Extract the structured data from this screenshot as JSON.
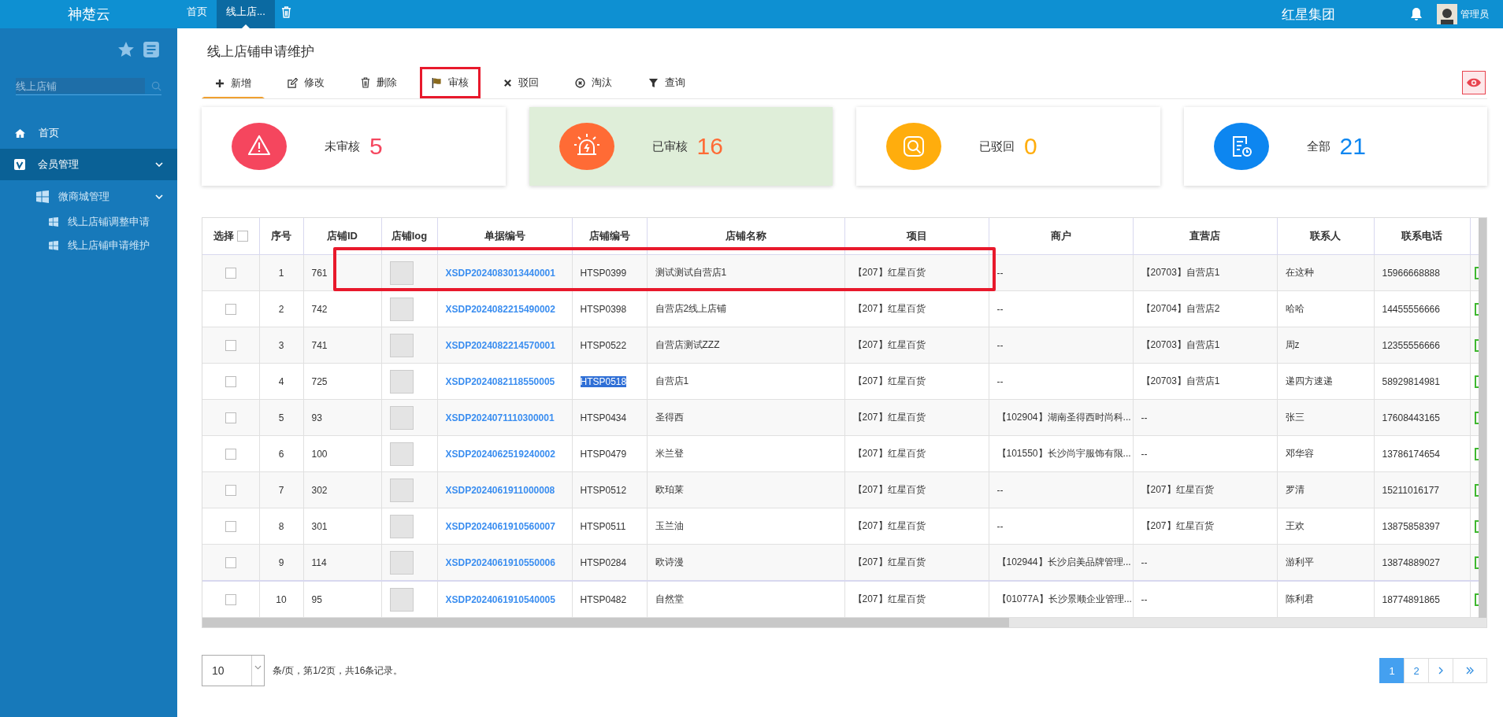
{
  "app": {
    "logo": "神楚云"
  },
  "top_tabs": [
    {
      "label": "首页",
      "selected": false
    },
    {
      "label": "线上店...",
      "selected": true
    }
  ],
  "company": "红星集团",
  "user": {
    "name": "管理员"
  },
  "sidebar": {
    "search": {
      "placeholder": "线上店铺"
    },
    "items": [
      {
        "label": "首页",
        "kind": "home",
        "selected": false
      },
      {
        "label": "会员管理",
        "kind": "badge",
        "selected": true,
        "expanded": true,
        "children": [
          {
            "label": "微商城管理",
            "selected": false,
            "expanded": true,
            "children": [
              {
                "label": "线上店铺调整申请",
                "selected": false
              },
              {
                "label": "线上店铺申请维护",
                "selected": false
              }
            ]
          }
        ]
      }
    ]
  },
  "page_title": "线上店铺申请维护",
  "toolbar": [
    {
      "label": "新增",
      "kind": "add",
      "selected": true,
      "annotated": false
    },
    {
      "label": "修改",
      "kind": "edit",
      "selected": false,
      "annotated": false
    },
    {
      "label": "删除",
      "kind": "delete",
      "selected": false,
      "annotated": false
    },
    {
      "label": "审核",
      "kind": "approve",
      "selected": false,
      "annotated": true
    },
    {
      "label": "驳回",
      "kind": "reject",
      "selected": false,
      "annotated": false
    },
    {
      "label": "淘汰",
      "kind": "eliminate",
      "selected": false,
      "annotated": false
    },
    {
      "label": "查询",
      "kind": "filter",
      "selected": false,
      "annotated": false
    }
  ],
  "cards": [
    {
      "label": "未审核",
      "count": "5",
      "kind": "warning",
      "color": "#f5465e",
      "selected": false
    },
    {
      "label": "已审核",
      "count": "16",
      "kind": "alarm",
      "color": "#ff6b35",
      "selected": true
    },
    {
      "label": "已驳回",
      "count": "0",
      "kind": "search",
      "color": "#ffad0d",
      "selected": false
    },
    {
      "label": "全部",
      "count": "21",
      "kind": "document",
      "color": "#0d86f0",
      "selected": false
    }
  ],
  "table": {
    "header_checkbox": {
      "label": "选择",
      "checked": false
    },
    "columns": [
      "序号",
      "店铺ID",
      "店铺log",
      "单据编号",
      "店铺编号",
      "店铺名称",
      "项目",
      "商户",
      "直营店",
      "联系人",
      "联系电话"
    ],
    "rows": [
      {
        "checked": false,
        "annotated": true,
        "no": "1",
        "id": "761",
        "order": "XSDP2024083013440001",
        "code": "HTSP0399",
        "code_highlighted": false,
        "name": "测试测试自营店1",
        "project": "【207】红星百货",
        "merchant": "--",
        "store": "【20703】自营店1",
        "contact": "在这种",
        "phone": "15966668888"
      },
      {
        "checked": false,
        "annotated": false,
        "no": "2",
        "id": "742",
        "order": "XSDP2024082215490002",
        "code": "HTSP0398",
        "code_highlighted": false,
        "name": "自营店2线上店铺",
        "project": "【207】红星百货",
        "merchant": "--",
        "store": "【20704】自营店2",
        "contact": "哈哈",
        "phone": "14455556666"
      },
      {
        "checked": false,
        "annotated": false,
        "no": "3",
        "id": "741",
        "order": "XSDP2024082214570001",
        "code": "HTSP0522",
        "code_highlighted": false,
        "name": "自营店测试ZZZ",
        "project": "【207】红星百货",
        "merchant": "--",
        "store": "【20703】自营店1",
        "contact": "周z",
        "phone": "12355556666"
      },
      {
        "checked": false,
        "annotated": false,
        "no": "4",
        "id": "725",
        "order": "XSDP2024082118550005",
        "code": "HTSP0518",
        "code_highlighted": true,
        "name": "自营店1",
        "project": "【207】红星百货",
        "merchant": "--",
        "store": "【20703】自营店1",
        "contact": "递四方速递",
        "phone": "58929814981"
      },
      {
        "checked": false,
        "annotated": false,
        "no": "5",
        "id": "93",
        "order": "XSDP2024071110300001",
        "code": "HTSP0434",
        "code_highlighted": false,
        "name": "圣得西",
        "project": "【207】红星百货",
        "merchant": "【102904】湖南圣得西时尚科...",
        "store": "--",
        "contact": "张三",
        "phone": "17608443165"
      },
      {
        "checked": false,
        "annotated": false,
        "no": "6",
        "id": "100",
        "order": "XSDP2024062519240002",
        "code": "HTSP0479",
        "code_highlighted": false,
        "name": "米兰登",
        "project": "【207】红星百货",
        "merchant": "【101550】长沙尚宇服饰有限...",
        "store": "--",
        "contact": "邓华容",
        "phone": "13786174654"
      },
      {
        "checked": false,
        "annotated": false,
        "no": "7",
        "id": "302",
        "order": "XSDP2024061911000008",
        "code": "HTSP0512",
        "code_highlighted": false,
        "name": "欧珀莱",
        "project": "【207】红星百货",
        "merchant": "--",
        "store": "【207】红星百货",
        "contact": "罗清",
        "phone": "15211016177"
      },
      {
        "checked": false,
        "annotated": false,
        "no": "8",
        "id": "301",
        "order": "XSDP2024061910560007",
        "code": "HTSP0511",
        "code_highlighted": false,
        "name": "玉兰油",
        "project": "【207】红星百货",
        "merchant": "--",
        "store": "【207】红星百货",
        "contact": "王欢",
        "phone": "13875858397"
      },
      {
        "checked": false,
        "annotated": false,
        "no": "9",
        "id": "114",
        "order": "XSDP2024061910550006",
        "code": "HTSP0284",
        "code_highlighted": false,
        "name": "欧诗漫",
        "project": "【207】红星百货",
        "merchant": "【102944】长沙启美品牌管理...",
        "store": "--",
        "contact": "游利平",
        "phone": "13874889027"
      },
      {
        "checked": false,
        "annotated": false,
        "no": "10",
        "id": "95",
        "order": "XSDP2024061910540005",
        "code": "HTSP0482",
        "code_highlighted": false,
        "name": "自然堂",
        "project": "【207】红星百货",
        "merchant": "【01077A】长沙景顺企业管理...",
        "store": "--",
        "contact": "陈利君",
        "phone": "18774891865"
      }
    ]
  },
  "pagination": {
    "page_size": "10",
    "summary": "条/页，第1/2页，共16条记录。",
    "pages": [
      {
        "label": "1",
        "selected": true
      },
      {
        "label": "2",
        "selected": false
      }
    ]
  }
}
